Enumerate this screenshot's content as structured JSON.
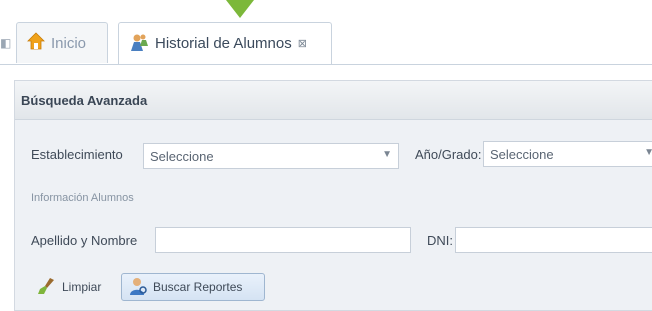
{
  "tabs": [
    {
      "label": "Inicio",
      "icon": "home-icon"
    },
    {
      "label": "Historial de Alumnos",
      "icon": "student-icon",
      "close": "⊠"
    }
  ],
  "panel": {
    "title": "Búsqueda Avanzada",
    "establecimiento": {
      "label": "Establecimiento",
      "value": "Seleccione"
    },
    "anio_grado": {
      "label": "Año/Grado:",
      "value": "Seleccione"
    },
    "section_label": "Información Alumnos",
    "apellido": {
      "label": "Apellido y Nombre",
      "value": ""
    },
    "dni": {
      "label": "DNI:",
      "value": ""
    }
  },
  "toolbar": {
    "limpiar_label": "Limpiar",
    "buscar_label": "Buscar Reportes"
  },
  "colors": {
    "accent": "#7cb83a",
    "tab_border": "#c9d3de"
  }
}
